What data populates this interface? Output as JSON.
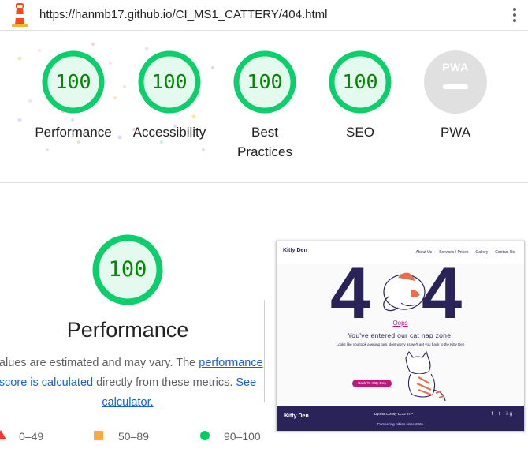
{
  "browser": {
    "url": "https://hanmb17.github.io/CI_MS1_CATTERY/404.html",
    "logo_icon": "lighthouse-icon",
    "menu_icon": "more-vert-icon"
  },
  "summary": [
    {
      "score": "100",
      "label": "Performance"
    },
    {
      "score": "100",
      "label": "Accessibility"
    },
    {
      "score": "100",
      "label": "Best Practices"
    },
    {
      "score": "100",
      "label": "SEO"
    }
  ],
  "pwa": {
    "badge": "PWA",
    "label": "PWA"
  },
  "performance": {
    "score": "100",
    "title": "Performance",
    "desc_prefix": "Values are estimated and may vary. The ",
    "desc_link1": "performance score is calculated",
    "desc_middle": " directly from these metrics. ",
    "desc_link2": "See calculator."
  },
  "legend": {
    "fail": "0–49",
    "average": "50–89",
    "pass": "90–100"
  },
  "colors": {
    "pass": "#0cce6b",
    "pass_text": "#008800",
    "pass_fill": "#e5faef",
    "average": "#ffaa33",
    "fail": "#ff3333",
    "link": "#1a5fd9"
  },
  "screenshot": {
    "logo": "Kitty Den",
    "nav": [
      "About Us",
      "Services / Prices",
      "Gallery",
      "Contact Us"
    ],
    "digit_left": "4",
    "digit_right": "4",
    "oops": "Oops",
    "headline": "You've entered our cat nap zone.",
    "subtext": "Looks like you took a wrong turn, dont worry as we'll get you back to the Kitty Den",
    "button": "Back To Kitty Den",
    "footer_logo": "Kitty Den",
    "footer_address": "Dyrrha Conwy LL32 8TP",
    "footer_copy": "Pampering Kitties since 2021",
    "footer_social": "f t ig"
  }
}
